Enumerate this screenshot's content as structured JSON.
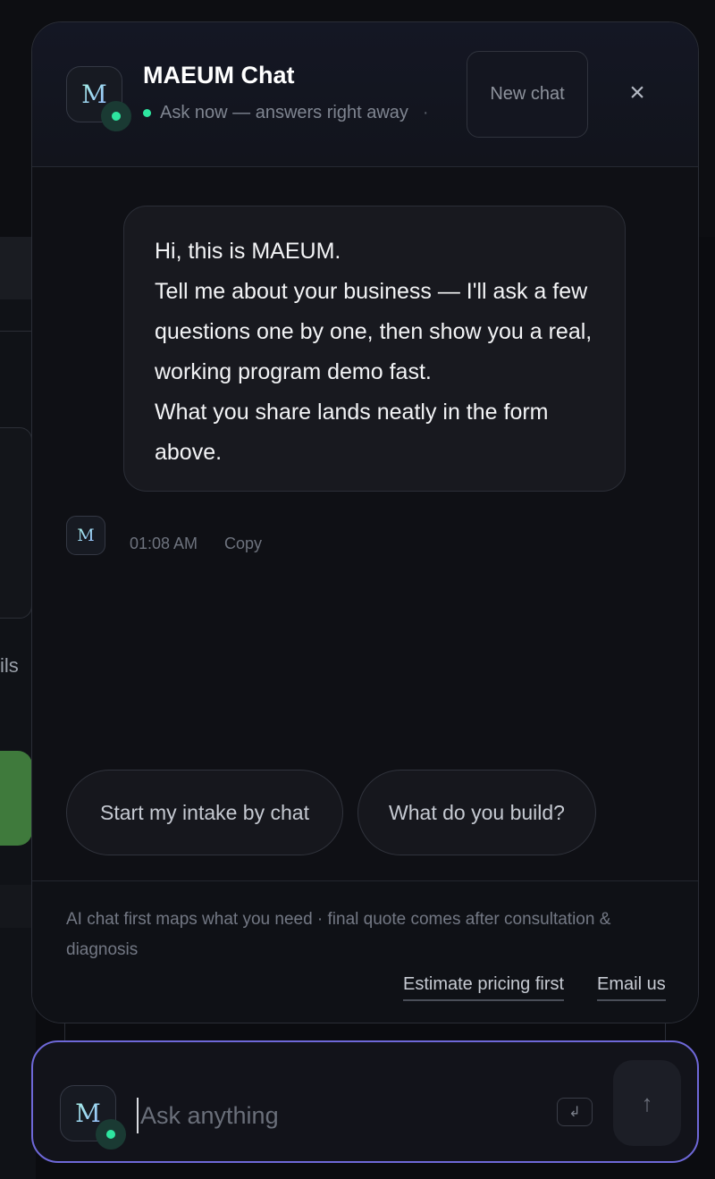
{
  "background_page": {
    "partial_text": "ils"
  },
  "chat": {
    "header": {
      "avatar_letter": "M",
      "title": "MAEUM Chat",
      "subtitle": "Ask now — answers right away",
      "subtitle_sep": "·",
      "new_chat_label": "New chat",
      "close_icon": "×"
    },
    "message": {
      "lines": [
        "Hi, this is MAEUM.",
        "Tell me about your business — I'll ask a few questions one by one, then show you a real, working program demo fast.",
        "What you share lands neatly in the form above."
      ],
      "avatar_letter": "M",
      "time": "01:08 AM",
      "copy_label": "Copy"
    },
    "suggestions": [
      {
        "label": "Start my intake by chat"
      },
      {
        "label": "What do you build?"
      }
    ],
    "footer": {
      "note": "AI chat first maps what you need · final quote comes after consultation & diagnosis",
      "links": [
        {
          "label": "Estimate pricing first"
        },
        {
          "label": "Email us"
        }
      ]
    }
  },
  "input": {
    "avatar_letter": "M",
    "placeholder": "Ask anything",
    "enter_icon": "↲",
    "send_icon": "↑"
  },
  "colors": {
    "accent_border": "#6e68d8",
    "status_green": "#2ee6a0",
    "background": "#0b0c10"
  }
}
